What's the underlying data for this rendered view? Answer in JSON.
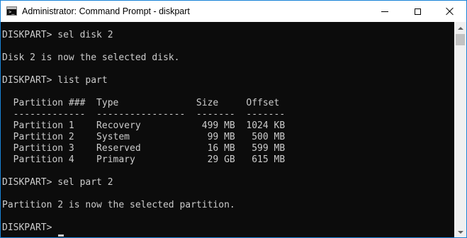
{
  "window": {
    "title": "Administrator: Command Prompt - diskpart"
  },
  "console": {
    "lines": [
      "DISKPART> sel disk 2",
      "",
      "Disk 2 is now the selected disk.",
      "",
      "DISKPART> list part",
      "",
      "  Partition ###  Type              Size     Offset",
      "  -------------  ----------------  -------  -------",
      "  Partition 1    Recovery           499 MB  1024 KB",
      "  Partition 2    System              99 MB   500 MB",
      "  Partition 3    Reserved            16 MB   599 MB",
      "  Partition 4    Primary             29 GB   615 MB",
      "",
      "DISKPART> sel part 2",
      "",
      "Partition 2 is now the selected partition.",
      "",
      "DISKPART> "
    ]
  },
  "colors": {
    "console_background": "#0c0c0c",
    "console_text": "#cccccc",
    "window_border": "#1883d7"
  },
  "icons": {
    "app": "command-prompt-icon",
    "minimize": "minimize-icon",
    "maximize": "maximize-icon",
    "close": "close-icon"
  }
}
